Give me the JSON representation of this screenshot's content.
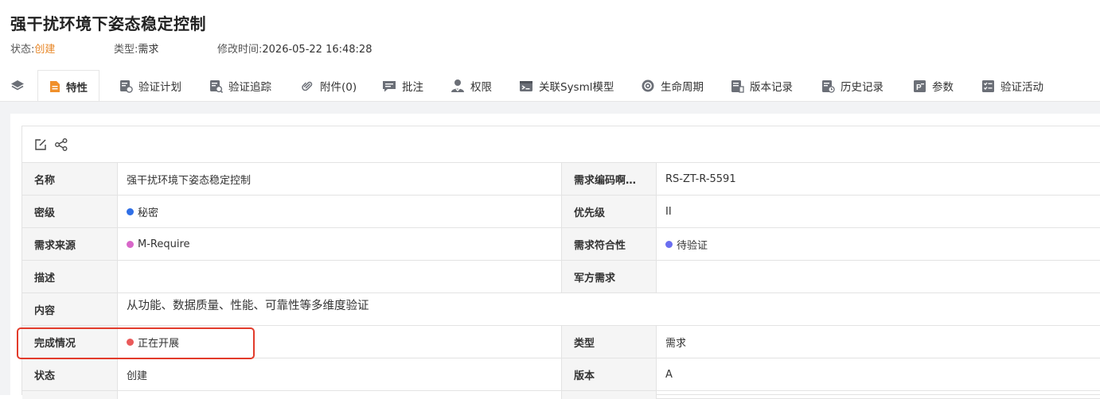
{
  "header": {
    "title": "强干扰环境下姿态稳定控制",
    "status_label": "状态:",
    "status_value": "创建",
    "type_label": "类型:",
    "type_value": "需求",
    "modified_label": "修改时间:",
    "modified_value": "2026-05-22 16:48:28"
  },
  "tabs": [
    {
      "label": "特性",
      "icon": "document-icon",
      "active": true
    },
    {
      "label": "验证计划",
      "icon": "plan-icon"
    },
    {
      "label": "验证追踪",
      "icon": "trace-icon"
    },
    {
      "label": "附件(0)",
      "icon": "paperclip-icon"
    },
    {
      "label": "批注",
      "icon": "comment-icon"
    },
    {
      "label": "权限",
      "icon": "user-lock-icon"
    },
    {
      "label": "关联Sysml模型",
      "icon": "model-icon"
    },
    {
      "label": "生命周期",
      "icon": "cycle-icon"
    },
    {
      "label": "版本记录",
      "icon": "version-icon"
    },
    {
      "label": "历史记录",
      "icon": "history-icon"
    },
    {
      "label": "参数",
      "icon": "parameter-icon"
    },
    {
      "label": "验证活动",
      "icon": "checklist-icon"
    }
  ],
  "toolbar": {
    "icons": [
      "edit-icon",
      "share-icon"
    ]
  },
  "fields": {
    "name_label": "名称",
    "name_value": "强干扰环境下姿态稳定控制",
    "code_label": "需求编码啊…",
    "code_value": "RS-ZT-R-5591",
    "secret_label": "密级",
    "secret_value": "秘密",
    "priority_label": "优先级",
    "priority_value": "II",
    "source_label": "需求来源",
    "source_value": "M-Require",
    "conform_label": "需求符合性",
    "conform_value": "待验证",
    "desc_label": "描述",
    "desc_value": "",
    "military_label": "军方需求",
    "military_value": "",
    "content_label": "内容",
    "content_value": "从功能、数据质量、性能、可靠性等多维度验证",
    "completion_label": "完成情况",
    "completion_value": "正在开展",
    "type_label": "类型",
    "type_value": "需求",
    "state_label": "状态",
    "state_value": "创建",
    "version_label": "版本",
    "version_value": "A"
  },
  "colors": {
    "status_orange": "#e8892b",
    "dot_secret": "#2f6fe6",
    "dot_source": "#d867c9",
    "dot_conform": "#6a6ef0",
    "dot_completion": "#ea5a5a",
    "highlight_border": "#e23b2b",
    "tab_active_icon": "#f0902b"
  }
}
